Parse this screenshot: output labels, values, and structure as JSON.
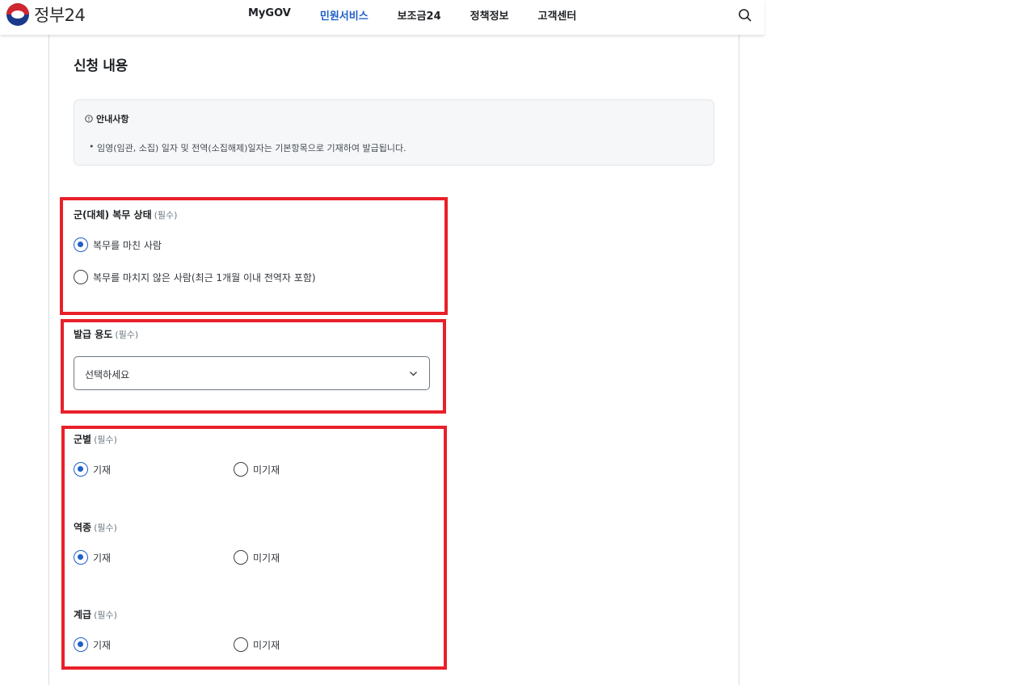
{
  "header": {
    "logo_text": "정부24",
    "nav": [
      "MyGOV",
      "민원서비스",
      "보조금24",
      "정책정보",
      "고객센터"
    ],
    "active_nav": "민원서비스",
    "search_icon": "search-icon"
  },
  "section": {
    "title": "신청 내용"
  },
  "notice": {
    "title": "안내사항",
    "icon": "info-circle-icon",
    "bullet": "•",
    "text": "임영(임관, 소집) 일자 및 전역(소집해제)일자는 기본항목으로 기재하여 발급됩니다."
  },
  "service_status": {
    "label": "군(대체) 복무 상태",
    "required": "(필수)",
    "options": [
      {
        "label": "복무를 마친 사람",
        "checked": true
      },
      {
        "label": "복무를 마치지 않은 사람(최근 1개월 이내 전역자 포함)",
        "checked": false
      }
    ]
  },
  "purpose": {
    "label": "발급 용도",
    "required": "(필수)",
    "placeholder": "선택하세요"
  },
  "branch": {
    "label": "군별",
    "required": "(필수)",
    "options": [
      {
        "label": "기재",
        "checked": true
      },
      {
        "label": "미기재",
        "checked": false
      }
    ]
  },
  "service_type": {
    "label": "역종",
    "required": "(필수)",
    "options": [
      {
        "label": "기재",
        "checked": true
      },
      {
        "label": "미기재",
        "checked": false
      }
    ]
  },
  "rank": {
    "label": "계급",
    "required": "(필수)",
    "options": [
      {
        "label": "기재",
        "checked": true
      },
      {
        "label": "미기재",
        "checked": false
      }
    ]
  },
  "colors": {
    "accent": "#1f5fc8",
    "highlight_box": "#e8202a"
  }
}
